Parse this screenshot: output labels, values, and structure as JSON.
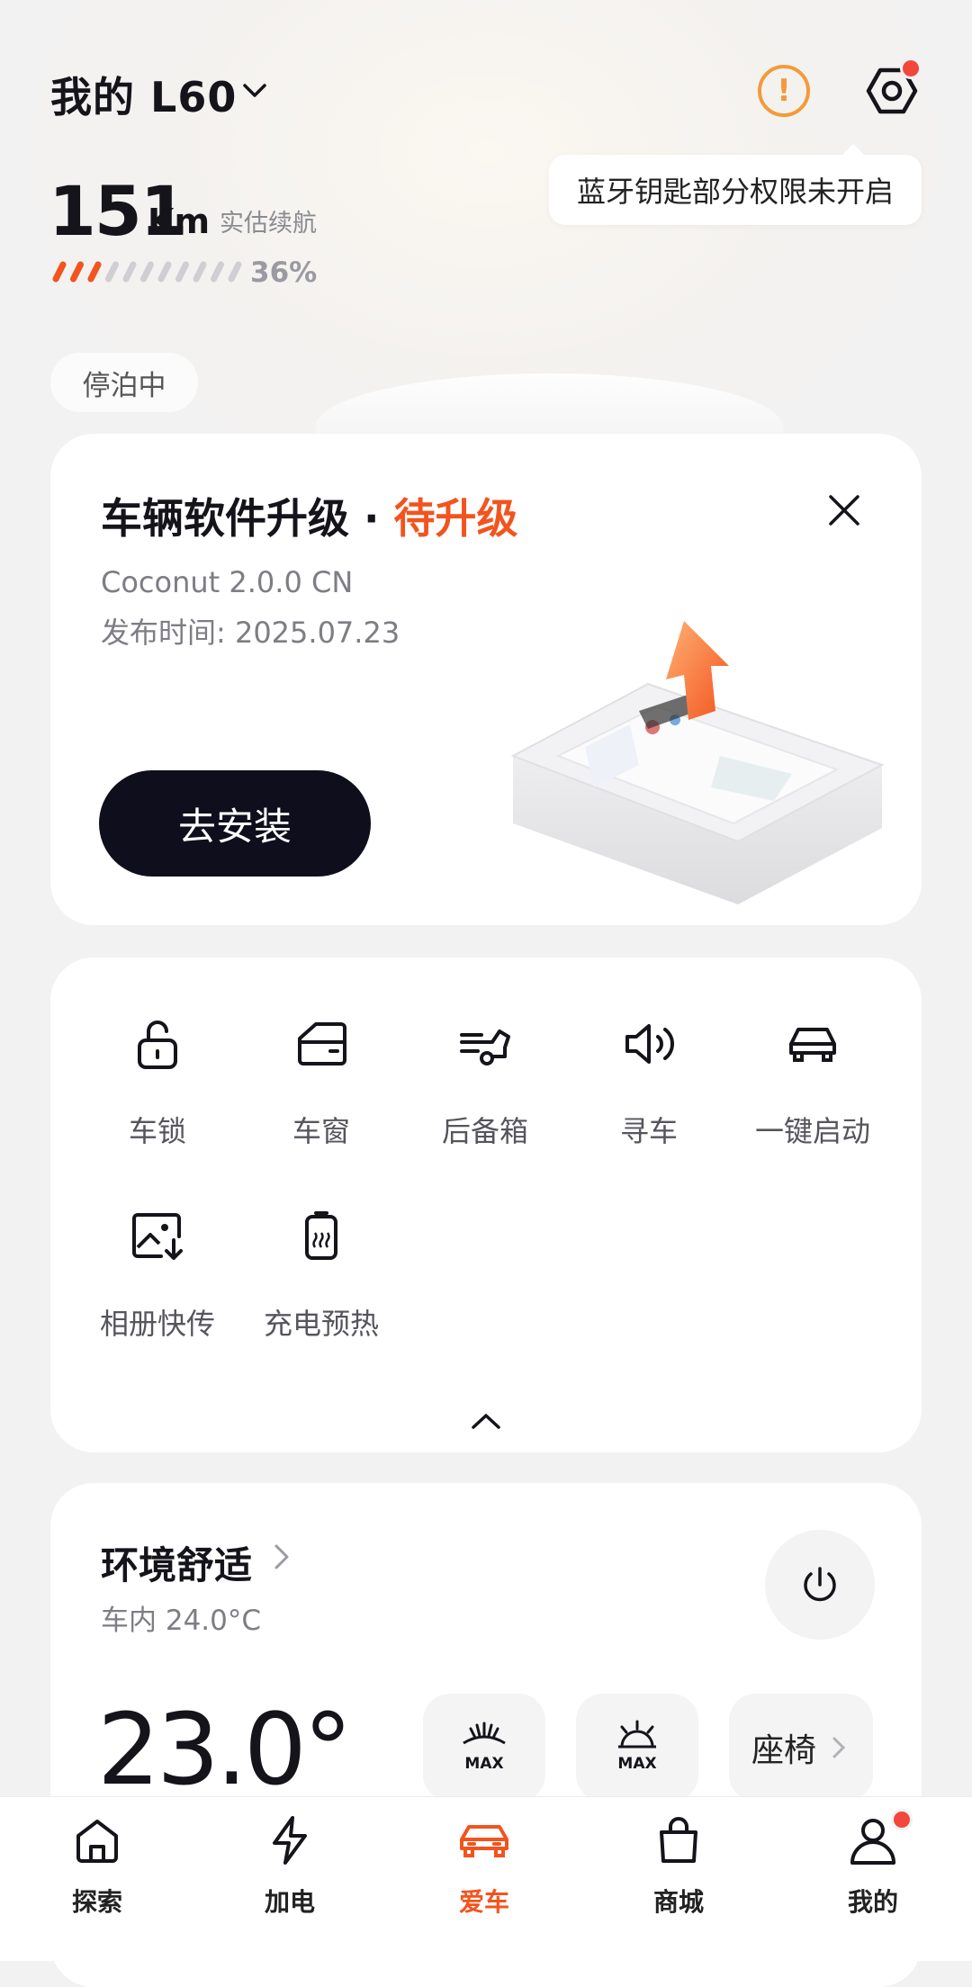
{
  "header": {
    "car_name": "我的 L60",
    "alert_icon": "alert-circle-icon",
    "settings_icon": "hexagon-settings-icon",
    "tooltip": "蓝牙钥匙部分权限未开启"
  },
  "range": {
    "value": "151",
    "unit": "Km",
    "label": "实估续航",
    "battery_percent_text": "36%",
    "battery_level": 0.36
  },
  "status_badge": "停泊中",
  "upgrade": {
    "title": "车辆软件升级 · ",
    "state": "待升级",
    "version": "Coconut 2.0.0 CN",
    "release_date": "发布时间: 2025.07.23",
    "install_label": "去安装"
  },
  "controls": [
    {
      "label": "车锁",
      "icon": "lock-icon"
    },
    {
      "label": "车窗",
      "icon": "window-icon"
    },
    {
      "label": "后备箱",
      "icon": "trunk-icon"
    },
    {
      "label": "寻车",
      "icon": "horn-icon"
    },
    {
      "label": "一键启动",
      "icon": "car-start-icon"
    },
    {
      "label": "相册快传",
      "icon": "photo-transfer-icon"
    },
    {
      "label": "充电预热",
      "icon": "battery-heat-icon"
    }
  ],
  "comfort": {
    "title": "环境舒适",
    "inside": "车内 24.0°C",
    "set_temp": "23.0°",
    "front_defrost": "MAX",
    "rear_defrost": "MAX",
    "seat_label": "座椅"
  },
  "tabs": [
    {
      "label": "探索",
      "icon": "home-icon"
    },
    {
      "label": "加电",
      "icon": "lightning-icon"
    },
    {
      "label": "爱车",
      "icon": "car-icon",
      "active": true
    },
    {
      "label": "商城",
      "icon": "shopping-bag-icon"
    },
    {
      "label": "我的",
      "icon": "profile-icon"
    }
  ],
  "colors": {
    "accent": "#f2541e",
    "warning": "#f29b3b",
    "dark_button": "#0e0e1c",
    "notification_dot": "#f2473a"
  }
}
